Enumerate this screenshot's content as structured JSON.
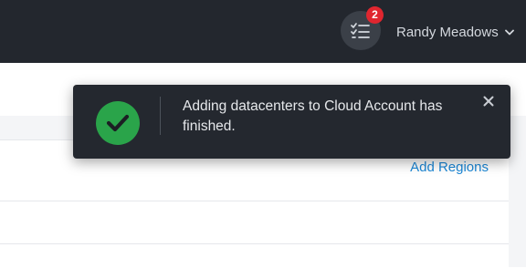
{
  "header": {
    "tasks_badge_count": "2",
    "tasks_icon": "task-list-icon",
    "user_name": "Randy Meadows",
    "user_menu_icon": "chevron-down-icon"
  },
  "content": {
    "add_regions_label": "Add Regions"
  },
  "toast": {
    "status": "success",
    "icon": "check-circle-icon",
    "message": "Adding datacenters to Cloud Account has finished.",
    "close_icon": "close-icon"
  },
  "colors": {
    "topbar_bg": "#23272e",
    "toast_bg": "#24282f",
    "success_green": "#2aa44a",
    "badge_red": "#e0262f",
    "link_blue": "#1b87d6"
  }
}
